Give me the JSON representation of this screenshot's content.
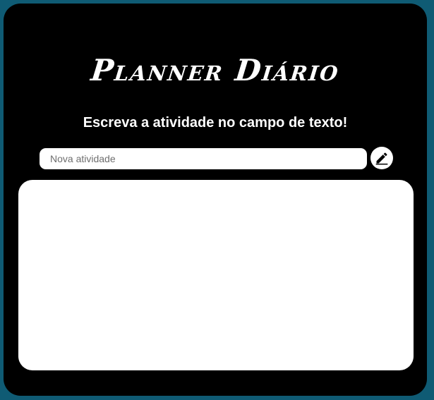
{
  "app": {
    "title": "Planner Diário",
    "subtitle": "Escreva a atividade no campo de texto!"
  },
  "task_input": {
    "value": "",
    "placeholder": "Nova atividade"
  },
  "add_button": {
    "icon": "pencil-icon"
  },
  "task_list": {
    "items": []
  },
  "colors": {
    "page_background": "#0f5b74",
    "app_background": "#000000",
    "text": "#ffffff",
    "panel": "#ffffff"
  }
}
